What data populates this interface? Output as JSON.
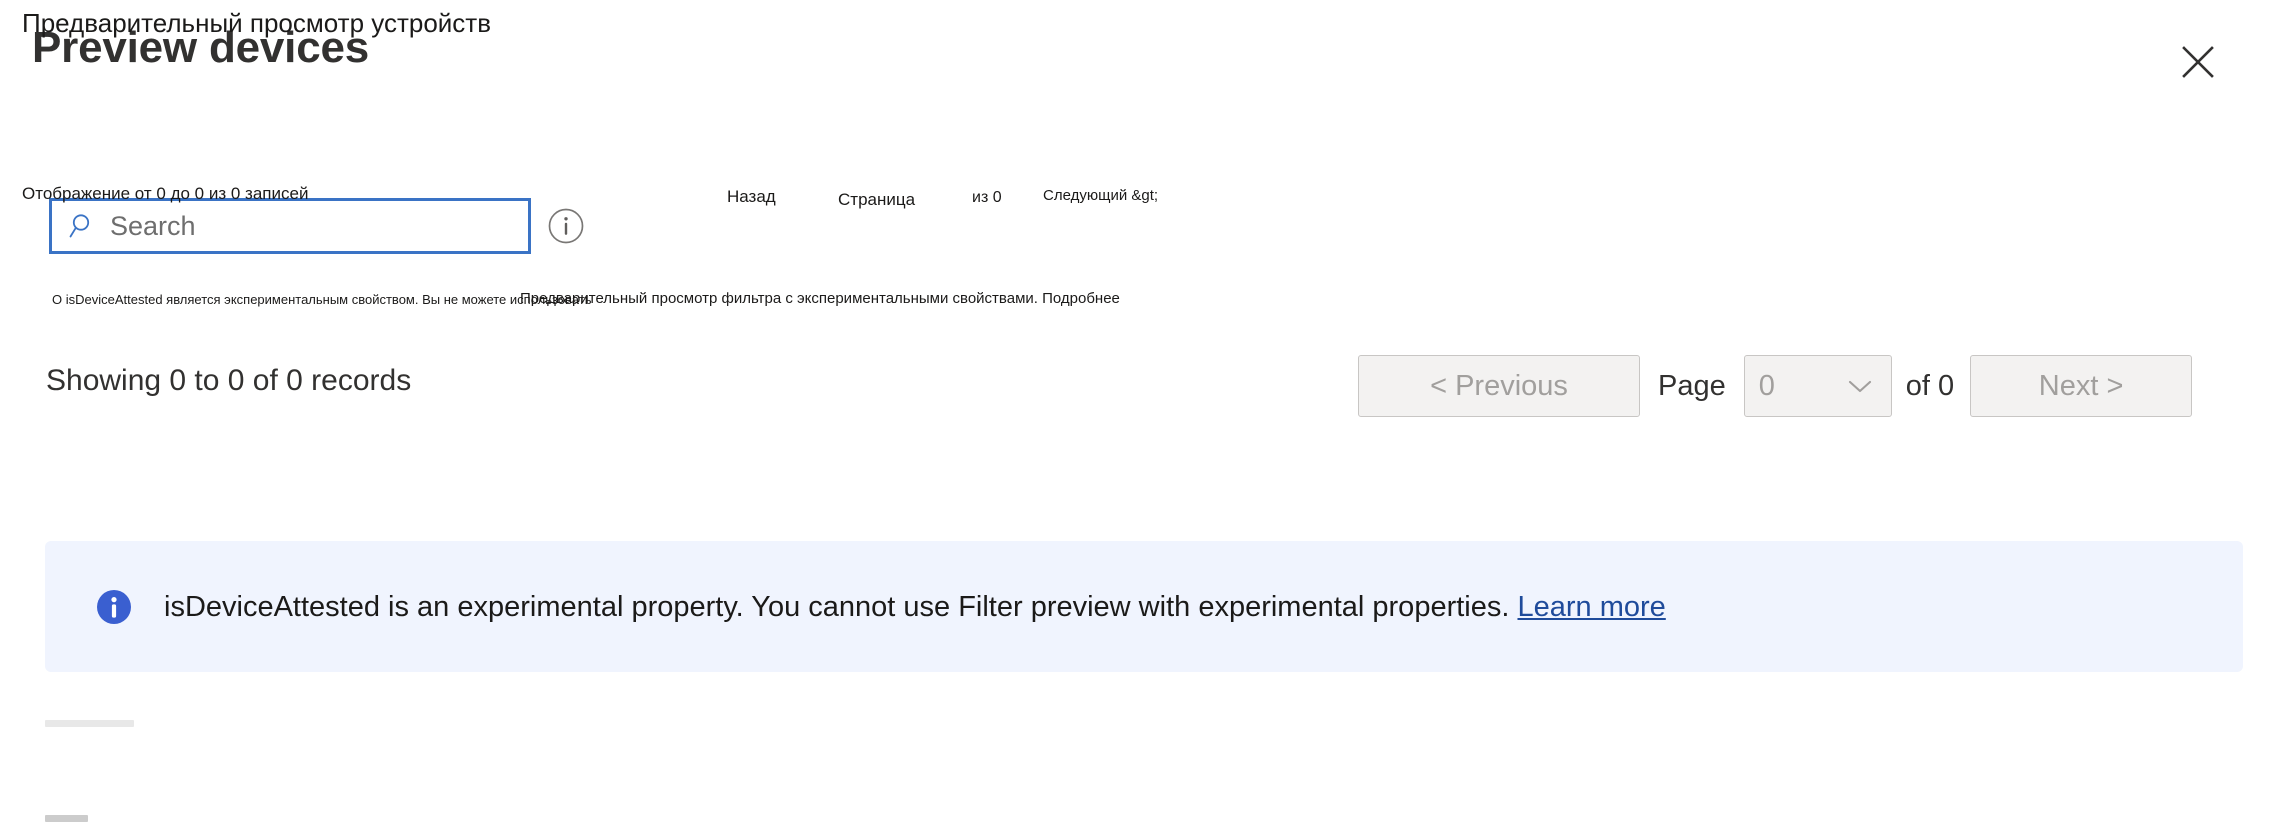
{
  "header": {
    "title": "Preview devices",
    "title_overlay_ru": "Предварительный просмотр устройств",
    "close_label": "close-icon"
  },
  "search": {
    "placeholder": "Search",
    "value": "",
    "icon": "search-icon",
    "info_icon": "info-outline-icon"
  },
  "overlays": {
    "showing_ru": "Отображение от 0 до 0 из 0 записей",
    "previous_ru": "Назад",
    "page_ru": "Страница",
    "of_ru": "из 0",
    "next_ru": "Следующий &gt;",
    "banner_ru_part1": "О isDeviceAttested является экспериментальным свойством. Вы не можете использовать",
    "banner_ru_part2": "Предварительный просмотр фильтра с экспериментальными свойствами. Подробнее"
  },
  "records": {
    "summary": "Showing 0 to 0 of 0 records"
  },
  "pagination": {
    "previous_label": "< Previous",
    "page_label": "Page",
    "page_value": "0",
    "of_label": "of 0",
    "next_label": "Next >",
    "chevron_icon": "chevron-down-icon",
    "previous_disabled": true,
    "next_disabled": true,
    "select_disabled": true
  },
  "banner": {
    "icon": "info-filled-icon",
    "message": "isDeviceAttested is an experimental property. You cannot use Filter preview with experimental properties.",
    "link_label": "Learn more",
    "background_color": "#f0f4fe",
    "icon_color": "#3a5fd0",
    "link_color": "#1f4b9b"
  },
  "theme": {
    "accent": "#3a73c5",
    "text": "#323130",
    "disabled_text": "#a19f9d",
    "button_bg": "#f3f2f1",
    "button_border": "#c8c6c4"
  }
}
